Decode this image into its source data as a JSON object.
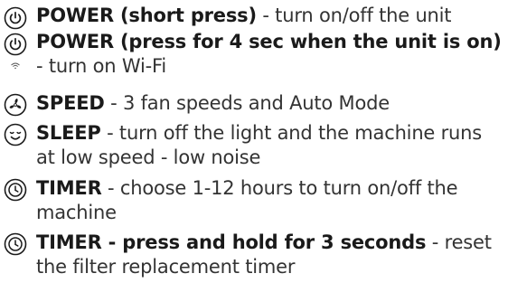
{
  "items": [
    {
      "icon": "power-icon",
      "bold": "POWER (short press)",
      "rest": " - turn on/off the unit"
    },
    {
      "icon": "power-icon",
      "bold": "POWER (press for 4 sec when the unit is on)",
      "rest": " - turn on Wi-Fi"
    },
    {
      "icon": "fan-icon",
      "bold": "SPEED",
      "rest": " - 3 fan speeds and Auto Mode"
    },
    {
      "icon": "sleep-icon",
      "bold": "SLEEP",
      "rest": " - turn off the light and the machine runs at low speed - low noise"
    },
    {
      "icon": "timer-icon",
      "bold": "TIMER",
      "rest": " - choose 1-12 hours to turn on/off the machine"
    },
    {
      "icon": "timer-icon",
      "bold": "TIMER - press and hold for 3 seconds",
      "rest": " - reset the filter replacement timer"
    }
  ]
}
